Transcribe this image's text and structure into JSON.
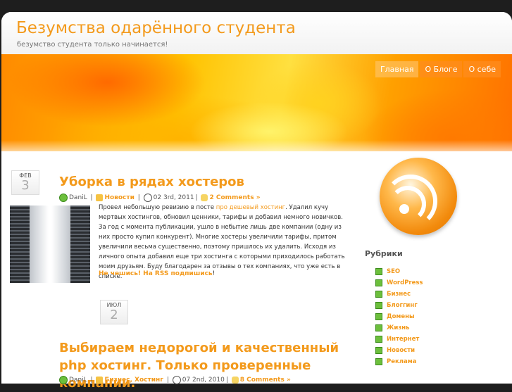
{
  "header": {
    "title": "Безумства одарённого студента",
    "tagline": "безумство студента только начинается!"
  },
  "nav": [
    "Главная",
    "О Блоге",
    "О себе"
  ],
  "posts": [
    {
      "month": "ФЕВ",
      "day": "3",
      "title": "Уборка в рядах хостеров",
      "author": "DaniL",
      "category": "Новости",
      "date": "02 3rd, 2011",
      "comments": "2 Comments »",
      "body_pre": "Провел небольшую ревизию в посте ",
      "body_link": "про дешевый хостинг",
      "body_post": ". Удалил кучу мертвых хостингов, обновил ценники, тарифы и добавил немного новичков. За год с момента публикации, ушло в небытие лишь две компании (одну из них просто купил конкурент). Многие хостеры увеличили тарифы, притом увеличили весьма существенно, поэтому пришлось их удалить. Исходя из личного опыта добавил еще три хостинга с которыми приходилось работать моим друзьям. Буду благодарен за отзывы о тех компаниях, что уже есть в списке.",
      "more_link": "Не чешись! На RSS подпишись",
      "more_tail": "!"
    },
    {
      "month": "ИЮЛ",
      "day": "2",
      "title": "Выбираем недорогой и качественный php хостинг. Только проверенные компании.",
      "author": "DaniL",
      "category": "Бизнес, Хостинг",
      "date": "07 2nd, 2010",
      "comments": "8 Comments »"
    }
  ],
  "sidebar": {
    "title": "Рубрики",
    "categories": [
      "SEO",
      "WordPress",
      "Бизнес",
      "Блоггинг",
      "Домены",
      "Жизнь",
      "Интернет",
      "Новости",
      "Реклама"
    ]
  },
  "colors": {
    "accent": "#f39a1c",
    "background": "#1e1e1e"
  }
}
